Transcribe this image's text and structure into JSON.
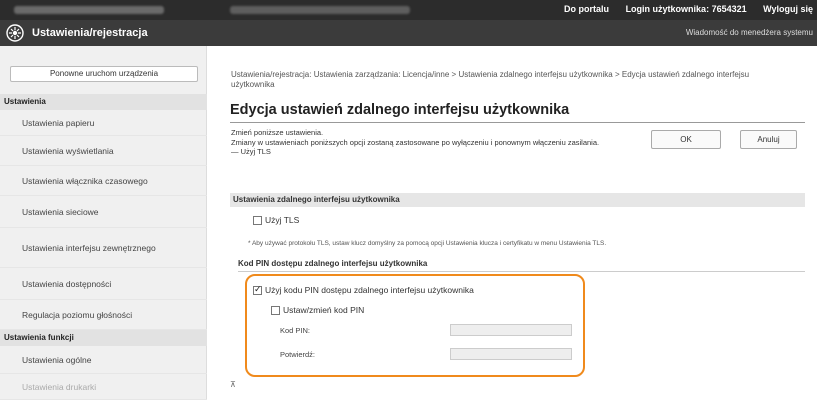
{
  "topbar": {
    "portal_link": "Do portalu",
    "login_label": "Login użytkownika:",
    "login_value": "7654321",
    "logout_link": "Wyloguj się"
  },
  "appbar": {
    "title": "Ustawienia/rejestracja",
    "message_link": "Wiadomość do menedżera systemu"
  },
  "sidebar": {
    "restart_button": "Ponowne uruchom urządzenia",
    "settings_header": "Ustawienia",
    "items": [
      "Ustawienia papieru",
      "Ustawienia wyświetlania",
      "Ustawienia włącznika czasowego",
      "Ustawienia sieciowe",
      "Ustawienia interfejsu zewnętrznego",
      "Ustawienia dostępności",
      "Regulacja poziomu głośności"
    ],
    "function_header": "Ustawienia funkcji",
    "function_items": [
      "Ustawienia ogólne",
      "Ustawienia drukarki"
    ]
  },
  "main": {
    "breadcrumb": "Ustawienia/rejestracja: Ustawienia zarządzania: Licencja/inne > Ustawienia zdalnego interfejsu użytkownika > Edycja ustawień zdalnego interfejsu użytkownika",
    "title": "Edycja ustawień zdalnego interfejsu użytkownika",
    "intro_line1": "Zmień poniższe ustawienia.",
    "intro_line2": "Zmiany w ustawieniach poniższych opcji zostaną zastosowane po wyłączeniu i ponownym włączeniu zasilania.",
    "intro_line3": "— Użyj TLS",
    "ok_button": "OK",
    "cancel_button": "Anuluj",
    "section_title": "Ustawienia zdalnego interfejsu użytkownika",
    "use_tls_label": "Użyj TLS",
    "use_tls_checked": false,
    "tls_note": "* Aby używać protokołu TLS, ustaw klucz domyślny za pomocą opcji Ustawienia klucza i certyfikatu w menu Ustawienia TLS.",
    "pin_section_title": "Kod PIN dostępu zdalnego interfejsu użytkownika",
    "use_pin_label": "Użyj kodu PIN dostępu zdalnego interfejsu użytkownika",
    "use_pin_checked": true,
    "set_pin_label": "Ustaw/zmień kod PIN",
    "set_pin_checked": false,
    "pin_label": "Kod PIN:",
    "confirm_label": "Potwierdź:",
    "pin_value": "",
    "confirm_value": "",
    "bottom_arrow": "⊼"
  },
  "colors": {
    "highlight": "#f08a1c",
    "topbar": "#2c2c2c",
    "appbar": "#3b3b3b"
  }
}
